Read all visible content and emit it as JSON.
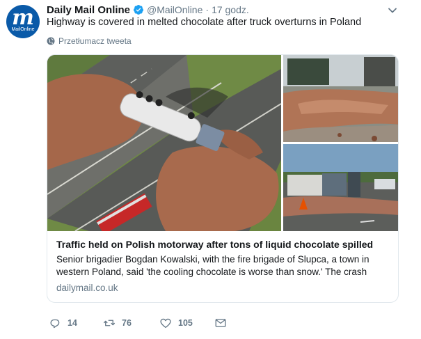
{
  "tweet": {
    "author_name": "Daily Mail Online",
    "handle": "@MailOnline",
    "separator": "·",
    "timestamp": "17 godz.",
    "text": "Highway is covered in melted chocolate after truck overturns in Poland",
    "translate_label": "Przetłumacz tweeta"
  },
  "avatar": {
    "logo_mark": "m",
    "logo_text": "MailOnline"
  },
  "card": {
    "title": "Traffic held on Polish motorway after tons of liquid chocolate spilled",
    "description": "Senior brigadier Bogdan Kowalski, with the fire brigade of Slupca, a town in western Poland, said 'the cooling chocolate is worse than snow.' The crash",
    "domain": "dailymail.co.uk",
    "images": [
      "aerial view of overturned tanker on chocolate-covered motorway",
      "close-up of spilled chocolate on road",
      "overturned truck on road side with traffic cone"
    ]
  },
  "actions": {
    "reply_count": "14",
    "retweet_count": "76",
    "like_count": "105"
  },
  "icons": [
    "verified-icon",
    "chevron-down-icon",
    "globe-icon",
    "reply-icon",
    "retweet-icon",
    "like-icon",
    "direct-message-icon"
  ],
  "colors": {
    "brand_blue": "#1da1f2",
    "text": "#14171a",
    "secondary": "#657786",
    "border": "#e1e8ed"
  }
}
